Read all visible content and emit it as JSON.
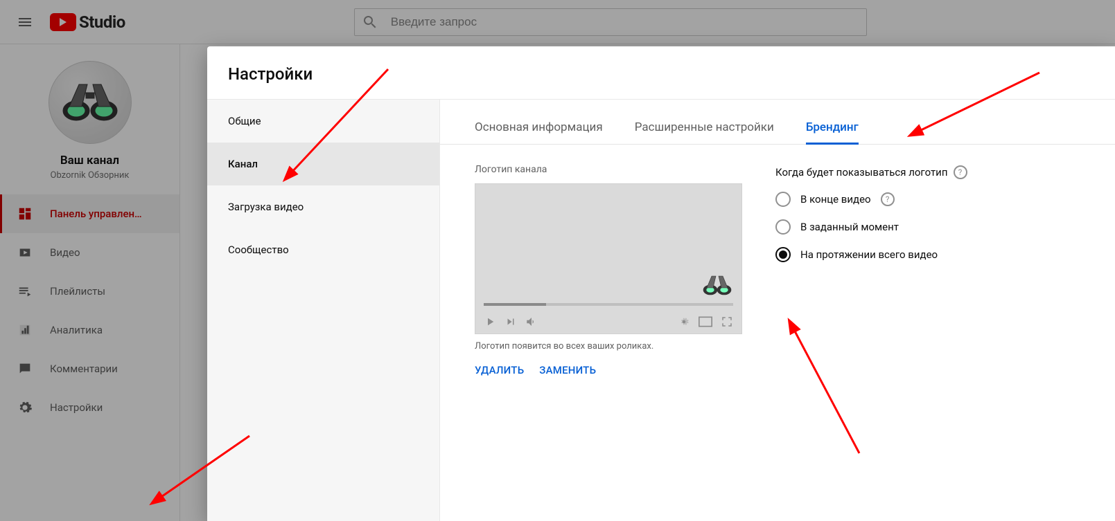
{
  "header": {
    "logo_text": "Studio",
    "search_placeholder": "Введите запрос"
  },
  "channel": {
    "title": "Ваш канал",
    "subtitle": "Obzornik Обзорник"
  },
  "sidebar": {
    "items": [
      {
        "label": "Панель управлен…"
      },
      {
        "label": "Видео"
      },
      {
        "label": "Плейлисты"
      },
      {
        "label": "Аналитика"
      },
      {
        "label": "Комментарии"
      },
      {
        "label": "Настройки"
      }
    ]
  },
  "modal": {
    "title": "Настройки",
    "nav": [
      {
        "label": "Общие"
      },
      {
        "label": "Канал"
      },
      {
        "label": "Загрузка видео"
      },
      {
        "label": "Сообщество"
      }
    ],
    "tabs": [
      {
        "label": "Основная информация"
      },
      {
        "label": "Расширенные настройки"
      },
      {
        "label": "Брендинг"
      }
    ],
    "branding": {
      "section_label": "Логотип канала",
      "caption": "Логотип появится во всех ваших роликах.",
      "delete_label": "УДАЛИТЬ",
      "replace_label": "ЗАМЕНИТЬ",
      "when_label": "Когда будет показываться логотип",
      "options": [
        {
          "label": "В конце видео",
          "help": true,
          "checked": false
        },
        {
          "label": "В заданный момент",
          "help": false,
          "checked": false
        },
        {
          "label": "На протяжении всего видео",
          "help": false,
          "checked": true
        }
      ]
    }
  }
}
